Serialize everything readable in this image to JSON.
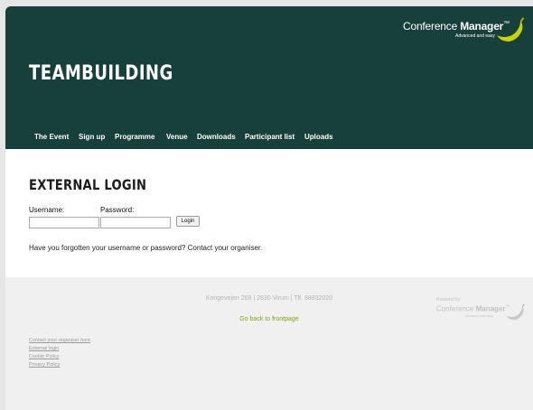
{
  "header": {
    "brand": {
      "name_regular": "Conference ",
      "name_bold": "Manager",
      "trademark": "™",
      "tagline": "Advanced and easy"
    },
    "site_title": "TEAMBUILDING",
    "nav": [
      {
        "label": "The Event"
      },
      {
        "label": "Sign up"
      },
      {
        "label": "Programme"
      },
      {
        "label": "Venue"
      },
      {
        "label": "Downloads"
      },
      {
        "label": "Participant list"
      },
      {
        "label": "Uploads"
      }
    ]
  },
  "login": {
    "title": "EXTERNAL LOGIN",
    "username_label": "Username:",
    "password_label": "Password:",
    "username_value": "",
    "password_value": "",
    "login_button": "Login",
    "forgot_text": "Have you forgotten your username or password? Contact your organiser."
  },
  "footer": {
    "address": "Kongevejen 268 | 2830 Virum | Tlf. 88832020",
    "frontpage_link": "Go back to frontpage",
    "powered_by": {
      "label": "Powered by",
      "name_regular": "Conference ",
      "name_bold": "Manager",
      "trademark": "™",
      "tagline": "Advanced and easy"
    },
    "links": [
      {
        "label": "Contact your organiser here"
      },
      {
        "label": "External login"
      },
      {
        "label": "Cookie Policy"
      },
      {
        "label": "Privacy Policy"
      }
    ]
  },
  "colors": {
    "header_bg": "#18403a",
    "accent_green": "#7ea21a",
    "logo_yellow": "#c8d400",
    "footer_bg": "#f0f0f0"
  },
  "icons": {
    "brand_logo": "banana-swoosh-logo-icon",
    "powered_logo": "banana-swoosh-logo-icon"
  }
}
